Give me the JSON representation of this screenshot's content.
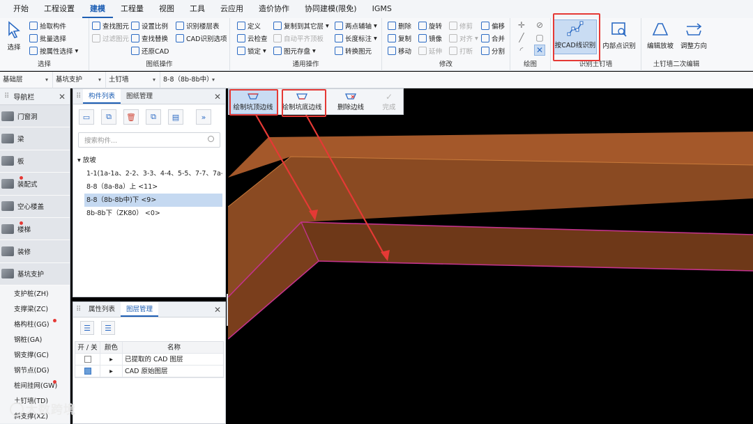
{
  "menu": {
    "items": [
      "开始",
      "工程设置",
      "建模",
      "工程量",
      "视图",
      "工具",
      "云应用",
      "造价协作",
      "协同建模(限免)",
      "IGMS"
    ],
    "active_index": 2
  },
  "ribbon": {
    "select": {
      "label": "选择",
      "pick": "拾取构件",
      "batch": "批量选择",
      "by_attr": "按属性选择",
      "group": "选择"
    },
    "drawing_ops": {
      "find_elem": "查找图元",
      "filter_elem": "过滤图元",
      "set_scale": "设置比例",
      "find_replace": "查找替换",
      "restore_cad": "还原CAD",
      "recognize_layer": "识别楼层表",
      "cad_options": "CAD识别选项",
      "group": "图纸操作"
    },
    "general_ops": {
      "define": "定义",
      "cloud_check": "云检查",
      "lock": "锁定",
      "copy_layer": "复制到其它层",
      "auto_flat": "自动平齐顶板",
      "elem_save": "图元存盘",
      "two_point_axis": "两点辅轴",
      "length_mark": "长度标注",
      "convert_elem": "转换图元",
      "group": "通用操作"
    },
    "modify": {
      "delete": "删除",
      "copy": "复制",
      "move": "移动",
      "rotate": "旋转",
      "mirror": "镜像",
      "extend": "延伸",
      "trim": "修剪",
      "align": "对齐",
      "break": "打断",
      "offset": "偏移",
      "merge": "合并",
      "split": "分割",
      "group": "修改"
    },
    "draw": {
      "group": "绘图"
    },
    "recognize": {
      "by_cad_line": "按CAD线识别",
      "inner_point": "内部点识别",
      "group": "识别土钉墙"
    },
    "secondary": {
      "edit_slope": "编辑放坡",
      "adjust_dir": "调整方向",
      "group": "土钉墙二次编辑"
    }
  },
  "selectors": {
    "floor": "基础层",
    "category": "基坑支护",
    "type": "土钉墙",
    "instance": "8-8（8b-8b中）"
  },
  "nav": {
    "title": "导航栏",
    "categories": [
      {
        "label": "门窗洞",
        "dot": false
      },
      {
        "label": "梁",
        "dot": false
      },
      {
        "label": "板",
        "dot": false
      },
      {
        "label": "装配式",
        "dot": true
      },
      {
        "label": "空心楼盖",
        "dot": false
      },
      {
        "label": "楼梯",
        "dot": true
      },
      {
        "label": "装修",
        "dot": false
      },
      {
        "label": "基坑支护",
        "dot": false
      }
    ],
    "subitems": [
      {
        "label": "支护桩(ZH)",
        "dot": false
      },
      {
        "label": "支撑梁(ZC)",
        "dot": false
      },
      {
        "label": "格构柱(GG)",
        "dot": true
      },
      {
        "label": "钢桩(GA)",
        "dot": false
      },
      {
        "label": "钢支撑(GC)",
        "dot": false
      },
      {
        "label": "钢节点(DG)",
        "dot": false
      },
      {
        "label": "桩间挂网(GW)",
        "dot": true
      },
      {
        "label": "土钉墙(TD)",
        "dot": false
      },
      {
        "label": "斜支撑(XZ)",
        "dot": false
      }
    ]
  },
  "component_panel": {
    "tabs": [
      "构件列表",
      "图纸管理"
    ],
    "search_placeholder": "搜索构件...",
    "tree_root": "放坡",
    "items": [
      "1-1(1a-1a、2-2、3-3、4-4、5-5、7-7、7a-7",
      "8-8（8a-8a）上 <11>",
      "8-8（8b-8b中)下 <9>",
      "8b-8b下（ZK80） <0>"
    ],
    "selected_index": 2
  },
  "layer_panel": {
    "tabs": [
      "属性列表",
      "图层管理"
    ],
    "headers": [
      "开 / 关",
      "颜色",
      "名称"
    ],
    "rows": [
      {
        "name": "已提取的 CAD 图层",
        "on": false
      },
      {
        "name": "CAD 原始图层",
        "on": true
      }
    ]
  },
  "viewport_toolbar": {
    "draw_top": "绘制坑顶边线",
    "draw_bottom": "绘制坑底边线",
    "delete_edge": "删除边线",
    "finish": "完成"
  },
  "colors": {
    "accent": "#1e5fb4",
    "highlight_red": "#e53935",
    "wall_brown": "#8a4a22",
    "wall_edge": "#c2338c"
  },
  "watermark": "大数跨境"
}
